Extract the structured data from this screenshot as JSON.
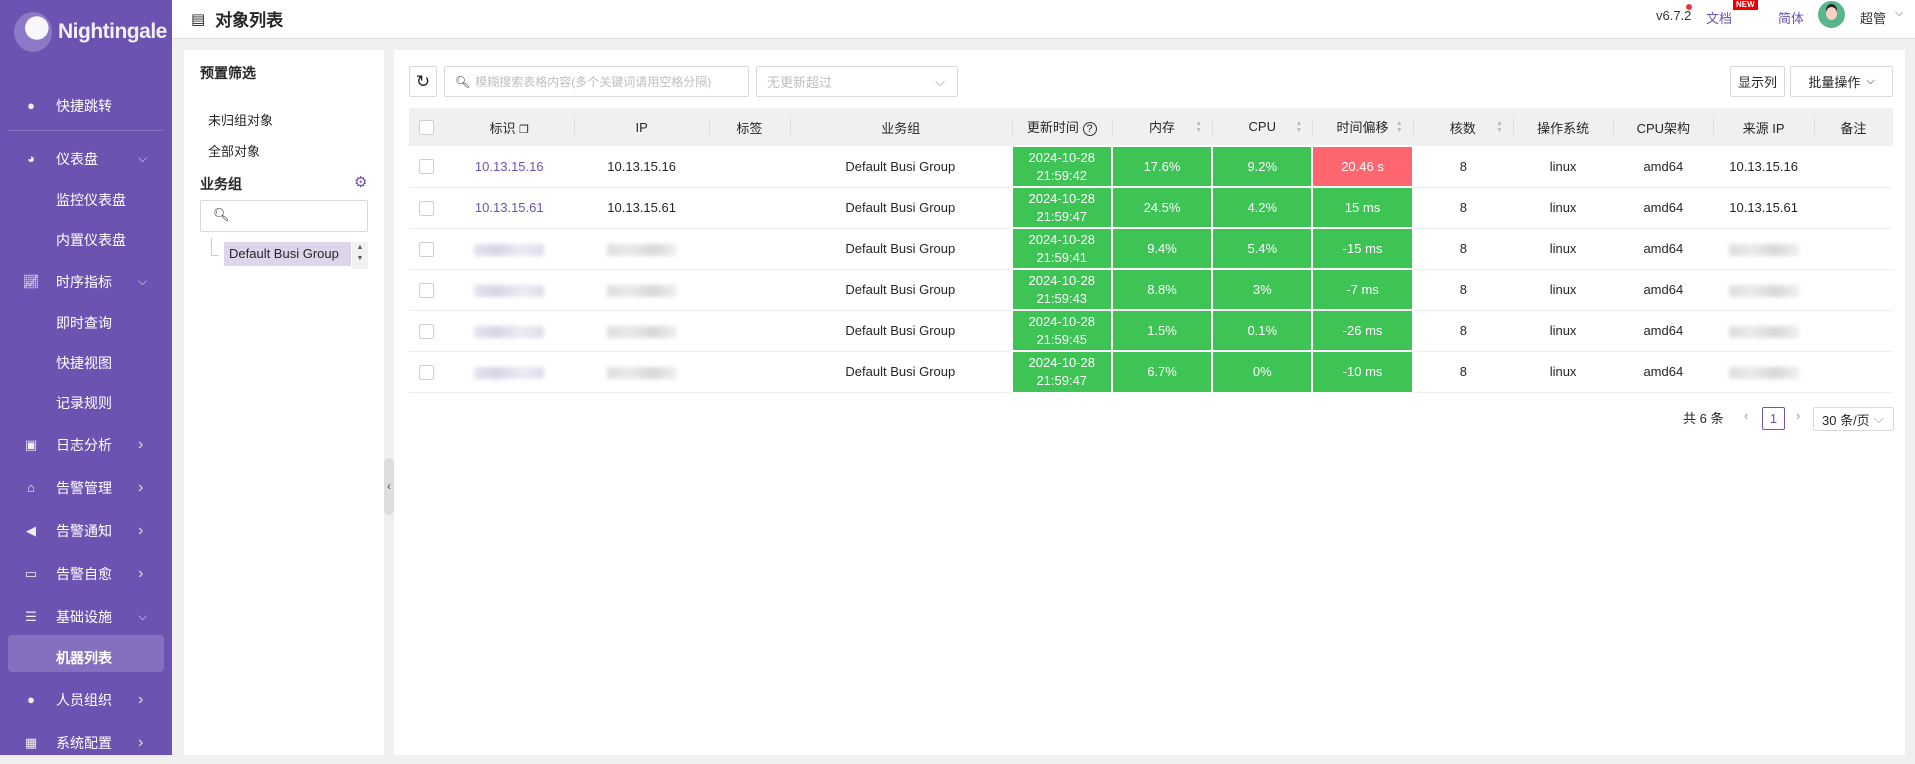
{
  "app": {
    "logo_text": "Nightingale",
    "page_title": "对象列表"
  },
  "header": {
    "version": "v6.7.2",
    "docs": "文档",
    "new_badge": "NEW",
    "language": "简体",
    "user": "超管"
  },
  "sidebar": {
    "items": [
      {
        "label": "快捷跳转",
        "icon": "search-icon"
      },
      {
        "label": "仪表盘",
        "icon": "dashboard-icon",
        "expanded": true
      },
      {
        "label": "监控仪表盘"
      },
      {
        "label": "内置仪表盘"
      },
      {
        "label": "时序指标",
        "icon": "chart-line-icon",
        "expanded": true
      },
      {
        "label": "即时查询"
      },
      {
        "label": "快捷视图"
      },
      {
        "label": "记录规则"
      },
      {
        "label": "日志分析",
        "icon": "log-icon"
      },
      {
        "label": "告警管理",
        "icon": "alarm-icon"
      },
      {
        "label": "告警通知",
        "icon": "megaphone-icon"
      },
      {
        "label": "告警自愈",
        "icon": "terminal-icon"
      },
      {
        "label": "基础设施",
        "icon": "server-icon",
        "expanded": true
      },
      {
        "label": "机器列表",
        "active": true
      },
      {
        "label": "人员组织",
        "icon": "user-icon"
      },
      {
        "label": "系统配置",
        "icon": "settings-grid-icon"
      }
    ]
  },
  "left_panel": {
    "preset_title": "预置筛选",
    "preset_items": [
      "未归组对象",
      "全部对象"
    ],
    "group_title": "业务组",
    "tree": [
      "Default Busi Group"
    ]
  },
  "toolbar": {
    "search_placeholder": "模糊搜索表格内容(多个关键词请用空格分隔)",
    "update_filter_placeholder": "无更新超过",
    "show_columns": "显示列",
    "batch_ops": "批量操作"
  },
  "table": {
    "columns": [
      "标识",
      "IP",
      "标签",
      "业务组",
      "更新时间",
      "内存",
      "CPU",
      "时间偏移",
      "核数",
      "操作系统",
      "CPU架构",
      "来源 IP",
      "备注"
    ],
    "rows": [
      {
        "ident": "10.13.15.16",
        "ip": "10.13.15.16",
        "tags": "",
        "group": "Default Busi Group",
        "date": "2024-10-28",
        "time": "21:59:42",
        "mem": "17.6%",
        "cpu": "9.2%",
        "offset": "20.46 s",
        "offset_status": "red",
        "cores": "8",
        "os": "linux",
        "arch": "amd64",
        "source_ip": "10.13.15.16",
        "note": ""
      },
      {
        "ident": "10.13.15.61",
        "ip": "10.13.15.61",
        "tags": "",
        "group": "Default Busi Group",
        "date": "2024-10-28",
        "time": "21:59:47",
        "mem": "24.5%",
        "cpu": "4.2%",
        "offset": "15 ms",
        "offset_status": "green",
        "cores": "8",
        "os": "linux",
        "arch": "amd64",
        "source_ip": "10.13.15.61",
        "note": ""
      },
      {
        "ident": null,
        "ip": null,
        "tags": "",
        "group": "Default Busi Group",
        "date": "2024-10-28",
        "time": "21:59:41",
        "mem": "9.4%",
        "cpu": "5.4%",
        "offset": "-15 ms",
        "offset_status": "green",
        "cores": "8",
        "os": "linux",
        "arch": "amd64",
        "source_ip": null,
        "note": ""
      },
      {
        "ident": null,
        "ip": null,
        "tags": "",
        "group": "Default Busi Group",
        "date": "2024-10-28",
        "time": "21:59:43",
        "mem": "8.8%",
        "cpu": "3%",
        "offset": "-7 ms",
        "offset_status": "green",
        "cores": "8",
        "os": "linux",
        "arch": "amd64",
        "source_ip": null,
        "note": ""
      },
      {
        "ident": null,
        "ip": null,
        "tags": "",
        "group": "Default Busi Group",
        "date": "2024-10-28",
        "time": "21:59:45",
        "mem": "1.5%",
        "cpu": "0.1%",
        "offset": "-26 ms",
        "offset_status": "green",
        "cores": "8",
        "os": "linux",
        "arch": "amd64",
        "source_ip": null,
        "note": ""
      },
      {
        "ident": null,
        "ip": null,
        "tags": "",
        "group": "Default Busi Group",
        "date": "2024-10-28",
        "time": "21:59:47",
        "mem": "6.7%",
        "cpu": "0%",
        "offset": "-10 ms",
        "offset_status": "green",
        "cores": "8",
        "os": "linux",
        "arch": "amd64",
        "source_ip": null,
        "note": ""
      }
    ]
  },
  "pagination": {
    "total": "共 6 条",
    "current": "1",
    "page_size": "30 条/页"
  },
  "colors": {
    "brand": "#6c53b1",
    "ok": "#3ec355",
    "alert": "#ff6670"
  }
}
